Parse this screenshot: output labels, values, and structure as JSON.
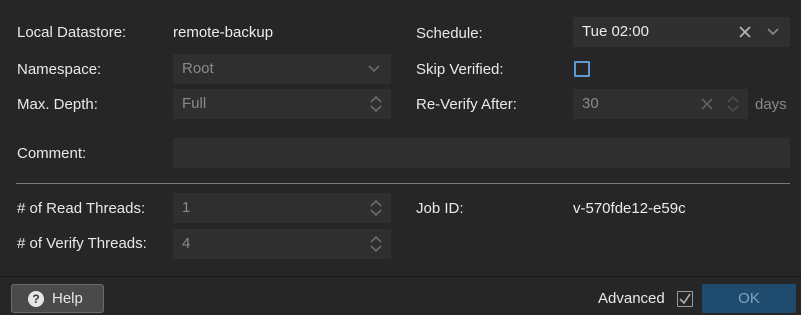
{
  "form": {
    "local_datastore": {
      "label": "Local Datastore:",
      "value": "remote-backup"
    },
    "namespace": {
      "label": "Namespace:",
      "value": "Root"
    },
    "max_depth": {
      "label": "Max. Depth:",
      "value": "Full"
    },
    "comment": {
      "label": "Comment:",
      "value": ""
    },
    "read_threads": {
      "label": "# of Read Threads:",
      "value": "1"
    },
    "verify_threads": {
      "label": "# of Verify Threads:",
      "value": "4"
    },
    "schedule": {
      "label": "Schedule:",
      "value": "Tue 02:00"
    },
    "skip_verified": {
      "label": "Skip Verified:",
      "checked": false
    },
    "reverify_after": {
      "label": "Re-Verify After:",
      "value": "30",
      "unit": "days"
    },
    "job_id": {
      "label": "Job ID:",
      "value": "v-570fde12-e59c"
    }
  },
  "footer": {
    "help_label": "Help",
    "advanced_label": "Advanced",
    "advanced_checked": true,
    "ok_label": "OK"
  },
  "colors": {
    "background": "#262626",
    "field": "#2f2f2f",
    "accent_checkbox": "#5d9bd6",
    "ok_button": "#1f4b6e"
  }
}
